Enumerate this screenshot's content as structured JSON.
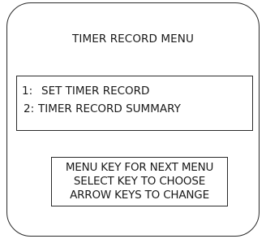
{
  "screen": {
    "title": "TIMER RECORD MENU"
  },
  "menu": {
    "items": [
      {
        "number": "1:",
        "label": "SET TIMER RECORD"
      },
      {
        "number": "2:",
        "label": "TIMER RECORD SUMMARY"
      }
    ]
  },
  "instructions": {
    "lines": [
      "MENU KEY FOR NEXT MENU",
      "SELECT KEY TO CHOOSE",
      "ARROW KEYS TO CHANGE"
    ]
  }
}
